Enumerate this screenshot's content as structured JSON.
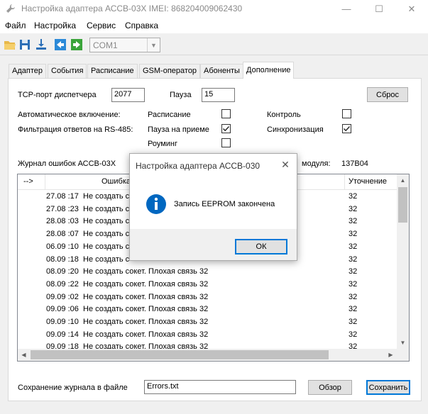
{
  "window": {
    "title": "Настройка адаптера АССВ-03Х    IMEI: 868204009062430",
    "minimize": "—",
    "maximize": "☐",
    "close": "✕"
  },
  "menu": {
    "file": "Файл",
    "settings": "Настройка",
    "service": "Сервис",
    "help": "Справка"
  },
  "toolbar": {
    "port_value": "COM1",
    "dropdown_arrow": "▼"
  },
  "tabs": [
    "Адаптер",
    "События",
    "Расписание",
    "GSM-оператор",
    "Абоненты",
    "Дополнение"
  ],
  "form": {
    "tcp_label": "TCP-порт диспетчера",
    "tcp_value": "2077",
    "pause_label": "Пауза",
    "pause_value": "15",
    "reset_button": "Сброс",
    "auto_on_label": "Автоматическое включение:",
    "rs485_label": "Фильтрация ответов на RS-485:",
    "schedule_label": "Расписание",
    "pause_receive_label": "Пауза на приеме",
    "roaming_label": "Роуминг",
    "control_label": "Контроль",
    "sync_label": "Синхронизация",
    "checks": {
      "schedule": false,
      "pause_receive": true,
      "roaming": false,
      "control": false,
      "sync": true
    },
    "log_label": "Журнал ошибок АССВ-03Х",
    "module_label": "модуля:",
    "module_value": "137B04"
  },
  "list": {
    "headers": {
      "arrow": "-->",
      "error": "Ошибка",
      "detail": "Уточнение"
    },
    "rows": [
      {
        "date": "27.08 :17",
        "msg": "Не создать с",
        "val": "32"
      },
      {
        "date": "27.08 :23",
        "msg": "Не создать с",
        "val": "32"
      },
      {
        "date": "28.08 :03",
        "msg": "Не создать с",
        "val": "32"
      },
      {
        "date": "28.08 :07",
        "msg": "Не создать с",
        "val": "32"
      },
      {
        "date": "06.09 :10",
        "msg": "Не создать с",
        "val": "32"
      },
      {
        "date": "08.09 :18",
        "msg": "Не создать с",
        "val": "32"
      },
      {
        "date": "08.09 :20",
        "msg": "Не создать сокет. Плохая связь  32",
        "val": "32"
      },
      {
        "date": "08.09 :22",
        "msg": "Не создать сокет. Плохая связь  32",
        "val": "32"
      },
      {
        "date": "09.09 :02",
        "msg": "Не создать сокет. Плохая связь  32",
        "val": "32"
      },
      {
        "date": "09.09 :06",
        "msg": "Не создать сокет. Плохая связь  32",
        "val": "32"
      },
      {
        "date": "09.09 :10",
        "msg": "Не создать сокет. Плохая связь  32",
        "val": "32"
      },
      {
        "date": "09.09 :14",
        "msg": "Не создать сокет. Плохая связь  32",
        "val": "32"
      },
      {
        "date": "09.09 :18",
        "msg": "Не создать сокет. Плохая связь  32",
        "val": "32"
      }
    ]
  },
  "save": {
    "label": "Сохранение журнала в файле",
    "filename": "Errors.txt",
    "browse_button": "Обзор",
    "save_button": "Сохранить"
  },
  "dialog": {
    "title": "Настройка адаптера АССВ-030",
    "close": "✕",
    "message": "Запись EEPROM закончена",
    "ok_button": "ОК"
  },
  "colors": {
    "accent": "#0078d7",
    "info_icon": "#0067c0"
  }
}
